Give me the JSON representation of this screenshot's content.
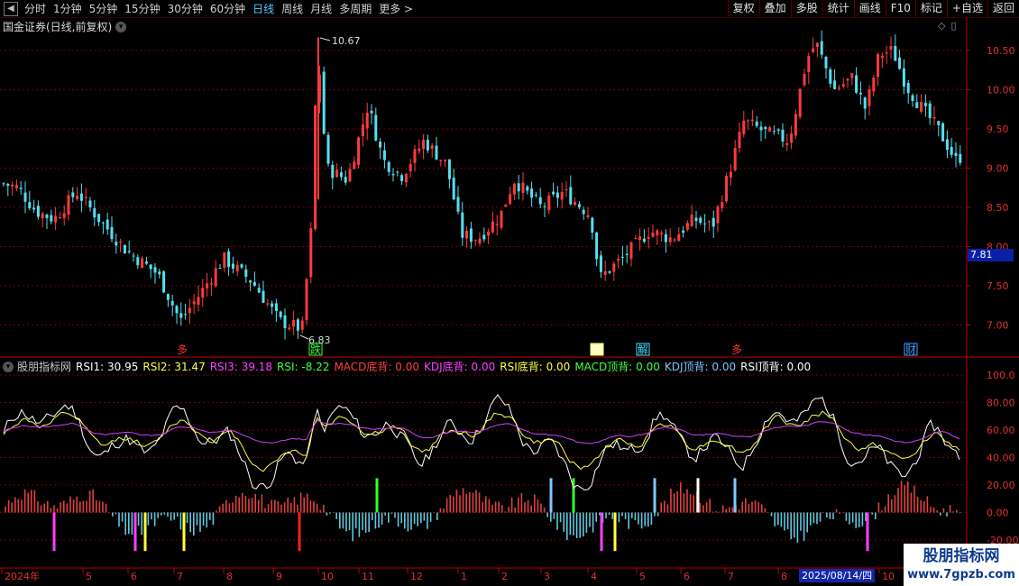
{
  "periods": [
    "分时",
    "1分钟",
    "5分钟",
    "15分钟",
    "30分钟",
    "60分钟",
    "日线",
    "周线",
    "月线",
    "多周期",
    "更多 >"
  ],
  "active_period": "日线",
  "tools": [
    "复权",
    "叠加",
    "多股",
    "统计",
    "画线",
    "F10",
    "标记",
    "+自选",
    "返回"
  ],
  "stock_title": "国金证券(日线,前复权)",
  "price_axis": [
    "10.50",
    "10.00",
    "9.50",
    "9.00",
    "8.50",
    "8.00",
    "7.50",
    "7.00"
  ],
  "current_price": "7.81",
  "high_label": "10.67",
  "low_label": "6.83",
  "markers": [
    {
      "text": "多",
      "color": "#ff3030"
    },
    {
      "text": "跌",
      "color": "#3cff3c"
    },
    {
      "text": "回",
      "color": "#ffff60"
    },
    {
      "text": "解",
      "color": "#40e0ff"
    },
    {
      "text": "多",
      "color": "#ff3030"
    },
    {
      "text": "财",
      "color": "#40a0ff"
    }
  ],
  "indicator": {
    "name": "股朋指标网",
    "values": [
      {
        "text": "RSI1: 30.95",
        "color": "#ffffff"
      },
      {
        "text": "RSI2: 31.47",
        "color": "#ffff40"
      },
      {
        "text": "RSI3: 39.18",
        "color": "#ff40ff"
      },
      {
        "text": "RSI: -8.22",
        "color": "#40ff40"
      },
      {
        "text": "MACD底背: 0.00",
        "color": "#ff4040"
      },
      {
        "text": "KDJ底背: 0.00",
        "color": "#ff40ff"
      },
      {
        "text": "RSI底背: 0.00",
        "color": "#ffff40"
      },
      {
        "text": "MACD顶背: 0.00",
        "color": "#40ff40"
      },
      {
        "text": "KDJ顶背: 0.00",
        "color": "#80c0ff"
      },
      {
        "text": "RSI顶背: 0.00",
        "color": "#ffffff"
      }
    ],
    "axis": [
      "100.0",
      "80.00",
      "60.00",
      "40.00",
      "20.00",
      "0.00",
      "-20.00"
    ]
  },
  "date_axis": [
    "2024年",
    "5",
    "6",
    "7",
    "8",
    "9",
    "10",
    "11",
    "12",
    "1",
    "2",
    "3",
    "4",
    "5",
    "6",
    "7",
    "8",
    "10"
  ],
  "date_highlight": "2025/08/14/四",
  "watermark": {
    "line1": "股朋指标网",
    "line2": "www.7gpzb.com"
  },
  "colors": {
    "up": "#ff3b3b",
    "down": "#54e0f0",
    "grid": "#7a0000",
    "axis": "#c00000"
  }
}
